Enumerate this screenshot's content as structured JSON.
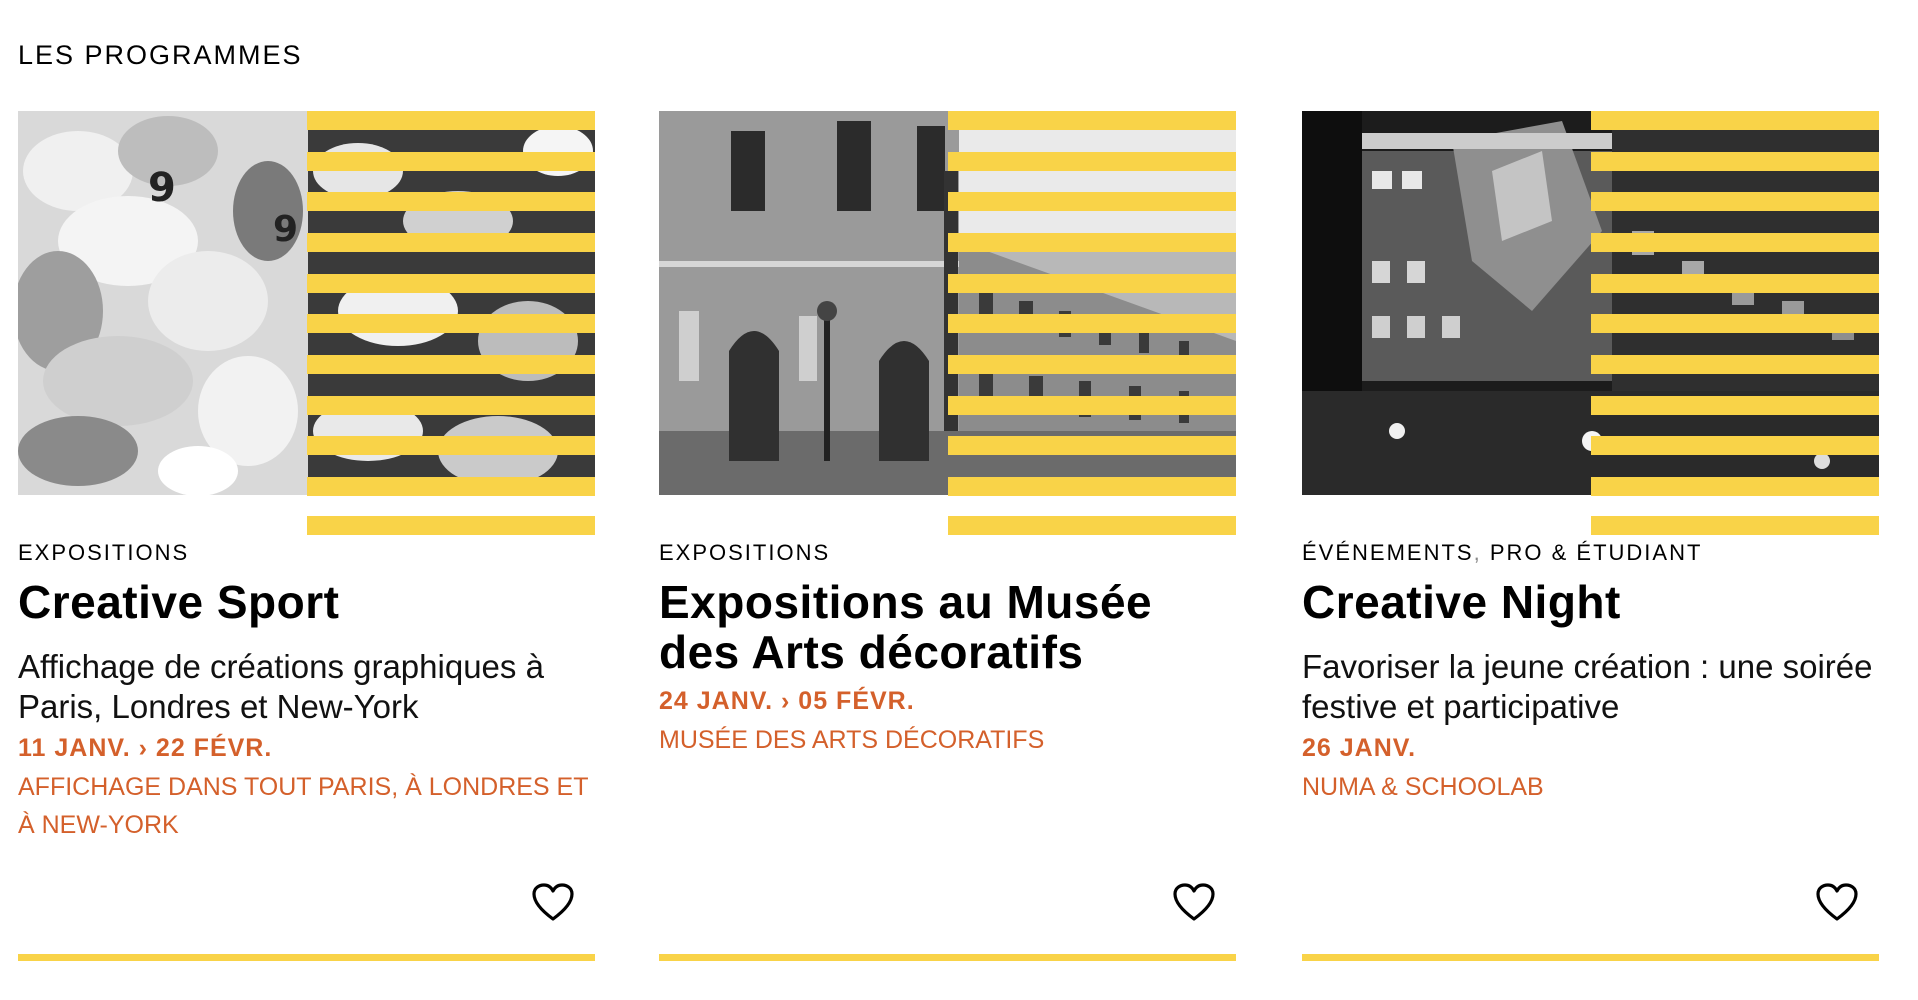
{
  "section": {
    "title": "LES PROGRAMMES"
  },
  "colors": {
    "accent_yellow": "#f9d348",
    "accent_orange": "#d4602b"
  },
  "cards": [
    {
      "categories": [
        "EXPOSITIONS"
      ],
      "title": "Creative Sport",
      "subtitle": "Affichage de créations graphiques à Paris, Londres et New-York",
      "dates": "11 JANV. › 22 FÉVR.",
      "place": "AFFICHAGE DANS TOUT PARIS, À LONDRES ET À NEW-YORK",
      "favorite_icon": "heart-outline-icon"
    },
    {
      "categories": [
        "EXPOSITIONS"
      ],
      "title": "Expositions au Musée des Arts décoratifs",
      "subtitle": "",
      "dates": "24 JANV. › 05 FÉVR.",
      "place": "MUSÉE DES ARTS DÉCORATIFS",
      "favorite_icon": "heart-outline-icon"
    },
    {
      "categories": [
        "ÉVÉNEMENTS",
        "PRO & ÉTUDIANT"
      ],
      "category_separator": ",",
      "title": "Creative Night",
      "subtitle": "Favoriser la jeune création : une soirée festive et participative",
      "dates": "26 JANV.",
      "place": "NUMA & SCHOOLAB",
      "favorite_icon": "heart-outline-icon"
    }
  ]
}
